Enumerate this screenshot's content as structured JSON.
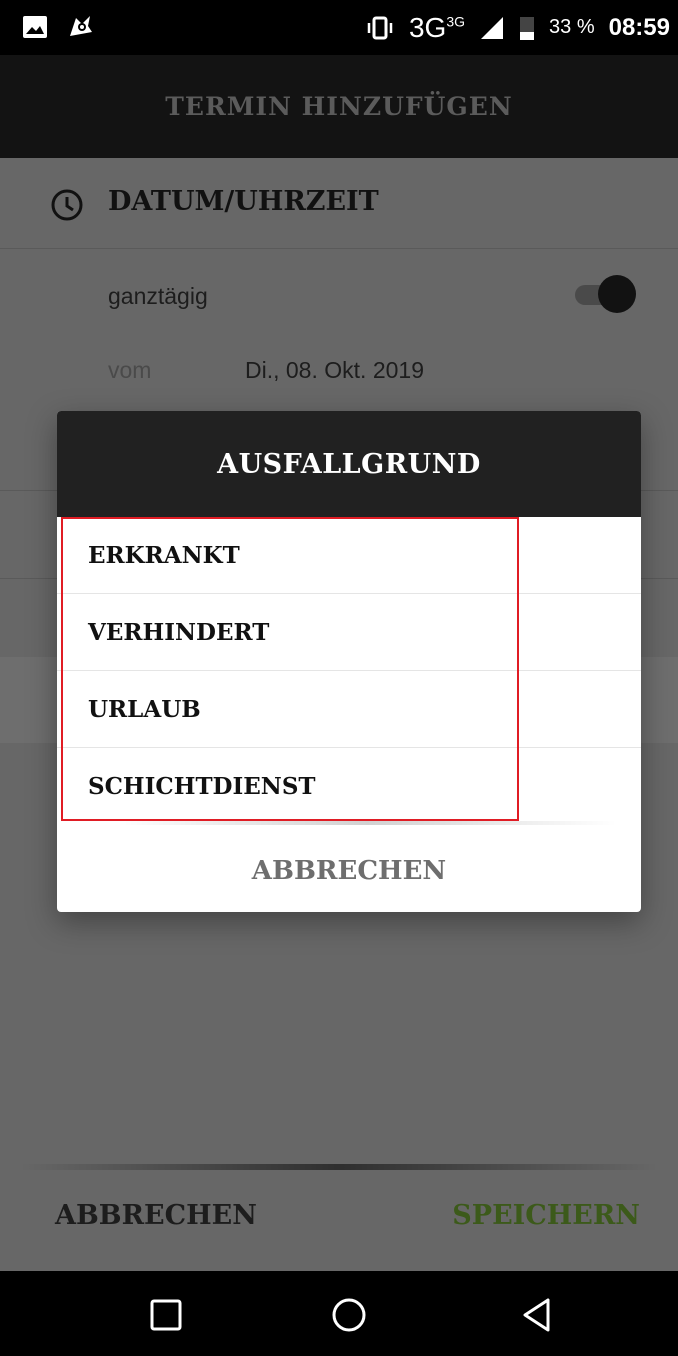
{
  "status_bar": {
    "network": "3G",
    "network_sup": "3G",
    "battery": "33 %",
    "time": "08:59",
    "icons": [
      "image-icon",
      "antivirus-icon",
      "vibrate-icon",
      "signal-icon",
      "battery-icon"
    ]
  },
  "header": {
    "title": "TERMIN HINZUFÜGEN"
  },
  "form": {
    "section_title": "DATUM/UHRZEIT",
    "allday_label": "ganztägig",
    "allday_on": true,
    "from_label": "vom",
    "from_date": "Di., 08. Okt. 2019"
  },
  "dialog": {
    "title": "AUSFALLGRUND",
    "options": [
      "ERKRANKT",
      "VERHINDERT",
      "URLAUB",
      "SCHICHTDIENST"
    ],
    "cancel_label": "ABBRECHEN"
  },
  "footer": {
    "cancel_label": "ABBRECHEN",
    "save_label": "SPEICHERN"
  },
  "colors": {
    "accent_save": "#3c5a1a",
    "highlight": "#e01c24",
    "header_bg": "#131313"
  }
}
